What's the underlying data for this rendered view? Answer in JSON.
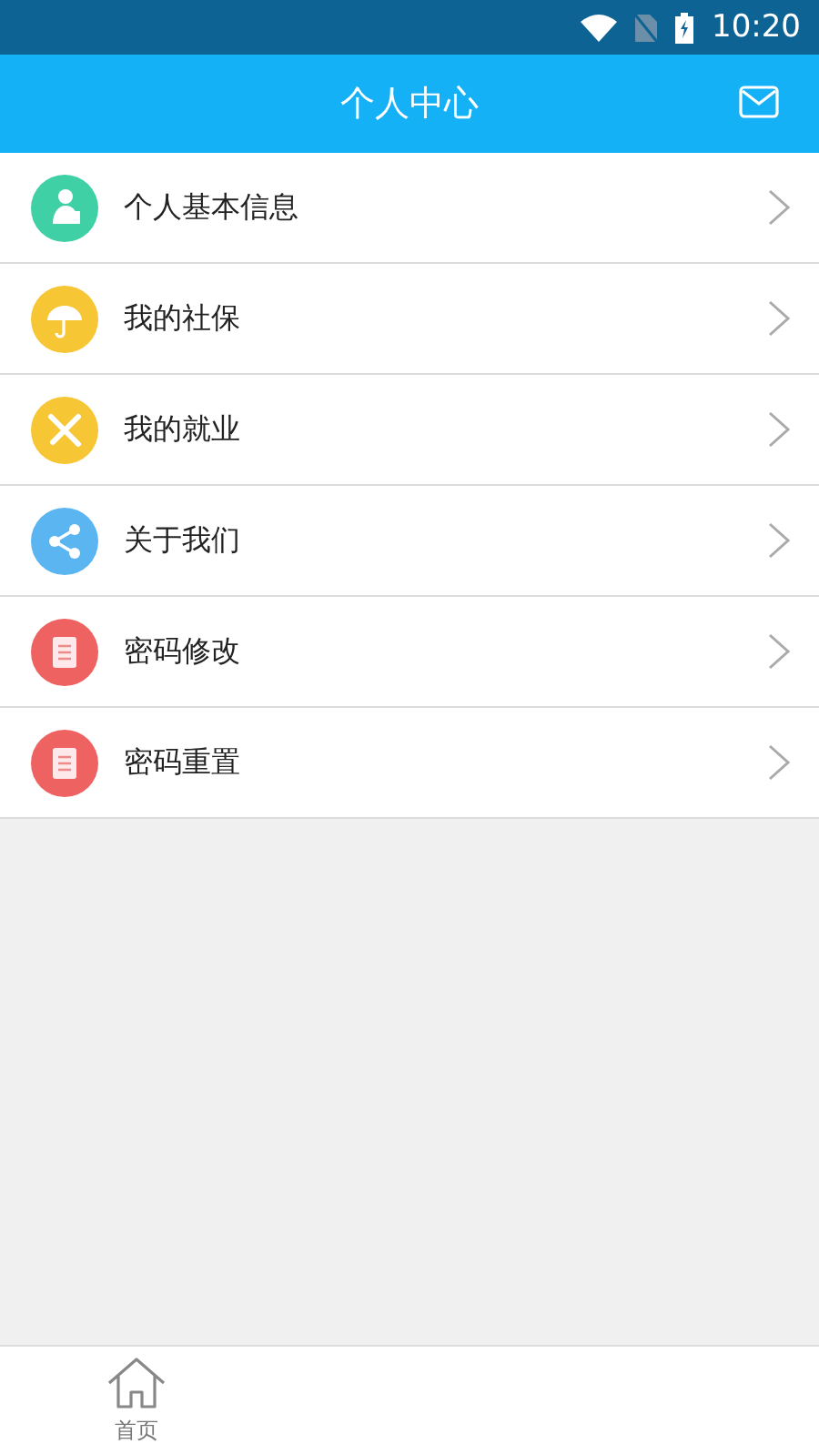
{
  "status_bar": {
    "time": "10:20"
  },
  "header": {
    "title": "个人中心"
  },
  "menu": [
    {
      "label": "个人基本信息",
      "kind": "person",
      "color": "#3fd0a6"
    },
    {
      "label": "我的社保",
      "kind": "umbrella",
      "color": "#f6c634"
    },
    {
      "label": "我的就业",
      "kind": "tools",
      "color": "#f6c634"
    },
    {
      "label": "关于我们",
      "kind": "share",
      "color": "#5bb5f0"
    },
    {
      "label": "密码修改",
      "kind": "document",
      "color": "#ef6262"
    },
    {
      "label": "密码重置",
      "kind": "document",
      "color": "#ef6262"
    }
  ],
  "tab_bar": [
    {
      "label": "首页",
      "kind": "home"
    }
  ]
}
